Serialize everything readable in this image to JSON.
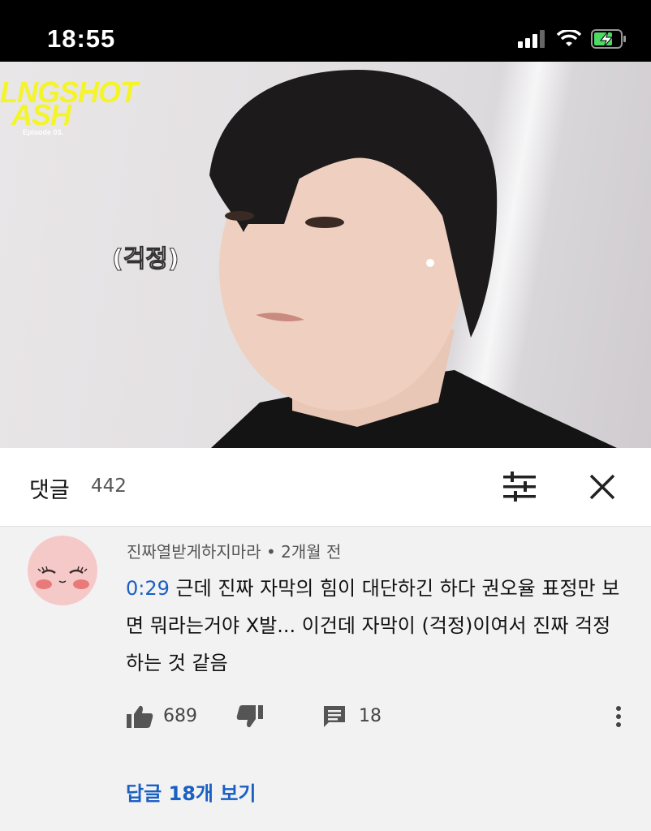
{
  "status_bar": {
    "time": "18:55"
  },
  "video": {
    "show_logo": "LNGSHOT",
    "show_logo_sub": "ASH",
    "episode": "Episode 03.",
    "subtitle": "(걱정)"
  },
  "comments": {
    "title": "댓글",
    "count": "442"
  },
  "comment": {
    "author": "진짜열받게하지마라",
    "separator": "•",
    "time_ago": "2개월 전",
    "timestamp": "0:29",
    "text": " 근데 진짜 자막의 힘이 대단하긴 하다 권오율 표정만 보면 뭐라는거야 X발... 이건데 자막이 (걱정)이여서 진짜 걱정하는 것 같음",
    "likes": "689",
    "replies_count": "18",
    "view_replies": "답글 18개 보기"
  },
  "colors": {
    "link": "#1a5fc4",
    "avatar_bg": "#f6c9c9"
  }
}
